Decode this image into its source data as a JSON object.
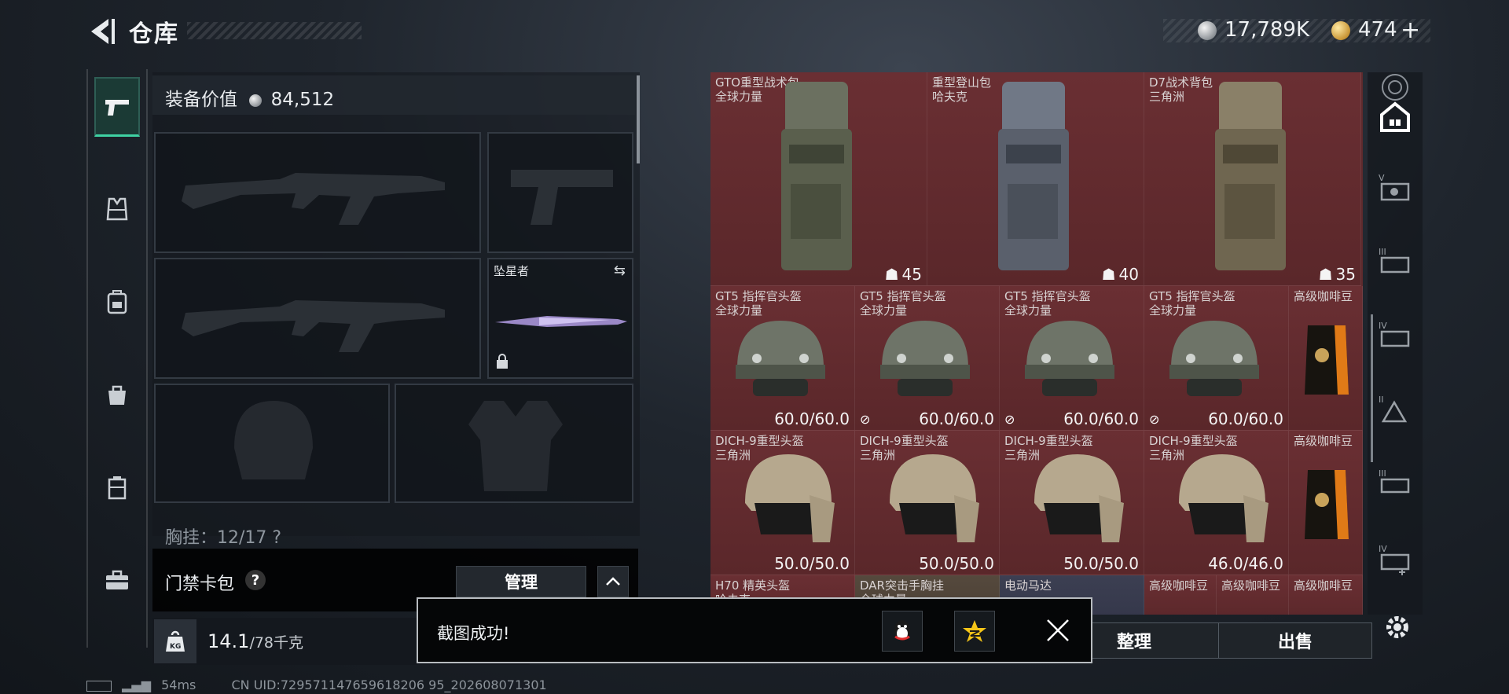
{
  "header": {
    "title": "仓库",
    "silver": "17,789K",
    "gold": "474",
    "gold_plus": "+"
  },
  "equipment": {
    "value_label": "装备价值",
    "value": "84,512",
    "melee_name": "坠星者",
    "chest_rig_text": "胸挂：12/17 ?"
  },
  "card_pack": {
    "label": "门禁卡包",
    "help": "?",
    "manage_label": "管理"
  },
  "weight": {
    "icon_text": "KG",
    "current": "14.1",
    "max": "/78千克"
  },
  "status": {
    "ping": "54ms",
    "uid": "CN UID:729571147659618206 95_202608071301"
  },
  "items_row1": [
    {
      "name": "GTO重型战术包",
      "sub": "全球力量",
      "cap": "45"
    },
    {
      "name": "重型登山包",
      "sub": "哈夫克",
      "cap": "40"
    },
    {
      "name": "D7战术背包",
      "sub": "三角洲",
      "cap": "35"
    }
  ],
  "items_row2": [
    {
      "name": "GT5 指挥官头盔",
      "sub": "全球力量",
      "val": "60.0/60.0"
    },
    {
      "name": "GT5 指挥官头盔",
      "sub": "全球力量",
      "val": "60.0/60.0"
    },
    {
      "name": "GT5 指挥官头盔",
      "sub": "全球力量",
      "val": "60.0/60.0"
    },
    {
      "name": "GT5 指挥官头盔",
      "sub": "全球力量",
      "val": "60.0/60.0"
    },
    {
      "name": "高级咖啡豆",
      "sub": "",
      "val": ""
    }
  ],
  "items_row3": [
    {
      "name": "DICH-9重型头盔",
      "sub": "三角洲",
      "val": "50.0/50.0"
    },
    {
      "name": "DICH-9重型头盔",
      "sub": "三角洲",
      "val": "50.0/50.0"
    },
    {
      "name": "DICH-9重型头盔",
      "sub": "三角洲",
      "val": "50.0/50.0"
    },
    {
      "name": "DICH-9重型头盔",
      "sub": "三角洲",
      "val": "46.0/46.0"
    },
    {
      "name": "高级咖啡豆",
      "sub": "",
      "val": ""
    }
  ],
  "items_row4": [
    {
      "name": "H70 精英头盔",
      "sub": "哈夫克"
    },
    {
      "name": "DAR突击手胸挂",
      "sub": "全球力量"
    },
    {
      "name": "电动马达",
      "sub": ""
    },
    {
      "name": "高级咖啡豆",
      "sub": ""
    },
    {
      "name": "高级咖啡豆",
      "sub": ""
    },
    {
      "name": "高级咖啡豆",
      "sub": ""
    }
  ],
  "actions": {
    "sort_label": "整理",
    "sell_label": "出售"
  },
  "toast": {
    "message": "截图成功!"
  },
  "colors": {
    "grid_bg": "#5e2a2d",
    "accent_green": "#3fd1a3"
  }
}
